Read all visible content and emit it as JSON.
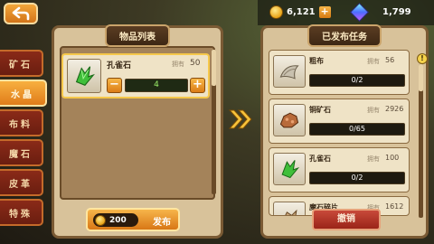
{
  "header": {
    "back_icon": "back-arrow-icon",
    "coins": "6,121",
    "gems": "1,799",
    "coin_plus": "+"
  },
  "categories": [
    {
      "label": "矿石",
      "active": false
    },
    {
      "label": "水晶",
      "active": true
    },
    {
      "label": "布料",
      "active": false
    },
    {
      "label": "魔石",
      "active": false
    },
    {
      "label": "皮革",
      "active": false
    },
    {
      "label": "特殊",
      "active": false
    }
  ],
  "item_panel": {
    "title": "物品列表",
    "item": {
      "name": "孔雀石",
      "owned_label": "拥有",
      "owned": "50",
      "quantity": "4",
      "minus": "−",
      "plus": "+"
    },
    "cost": "200",
    "publish_label": "发布"
  },
  "task_panel": {
    "title": "已发布任务",
    "tasks": [
      {
        "name": "粗布",
        "owned_label": "拥有",
        "owned": "56",
        "progress": "0/2",
        "icon": "cloth-icon"
      },
      {
        "name": "铜矿石",
        "owned_label": "拥有",
        "owned": "2926",
        "progress": "0/65",
        "icon": "copper-ore-icon"
      },
      {
        "name": "孔雀石",
        "owned_label": "拥有",
        "owned": "100",
        "progress": "0/2",
        "icon": "malachite-icon"
      },
      {
        "name": "魔石碎片",
        "owned_label": "拥有",
        "owned": "1612",
        "progress": "",
        "icon": "magic-stone-fragment-icon"
      }
    ],
    "cancel_label": "撤销",
    "info": "!"
  },
  "colors": {
    "accent": "#e07c1a",
    "panel": "#d8c29a",
    "progress_text": "#9cf06a"
  }
}
